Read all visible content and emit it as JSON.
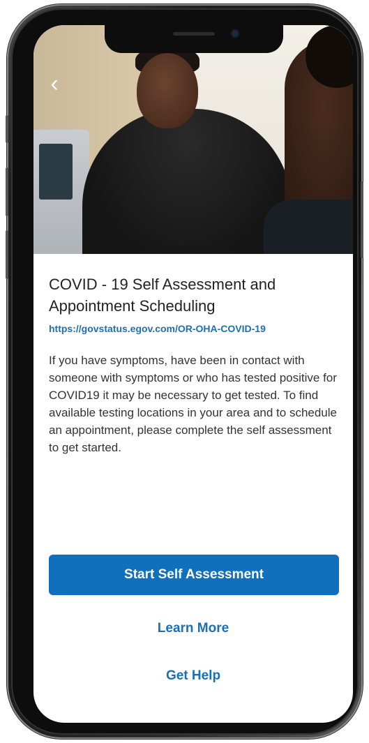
{
  "card": {
    "title": "COVID - 19 Self Assessment and Appointment Scheduling",
    "url": "https://govstatus.egov.com/OR-OHA-COVID-19",
    "description": "If you have symptoms, have been in contact with someone with symptoms or who has tested positive for COVID19 it may be necessary to get tested. To find available testing locations in your area and to schedule an appointment, please complete the self assessment to get started."
  },
  "actions": {
    "primary_label": "Start Self Assessment",
    "learn_more_label": "Learn More",
    "get_help_label": "Get Help"
  },
  "navigation": {
    "back_glyph": "‹"
  },
  "colors": {
    "accent": "#1170bd",
    "link": "#1a6fb7"
  }
}
